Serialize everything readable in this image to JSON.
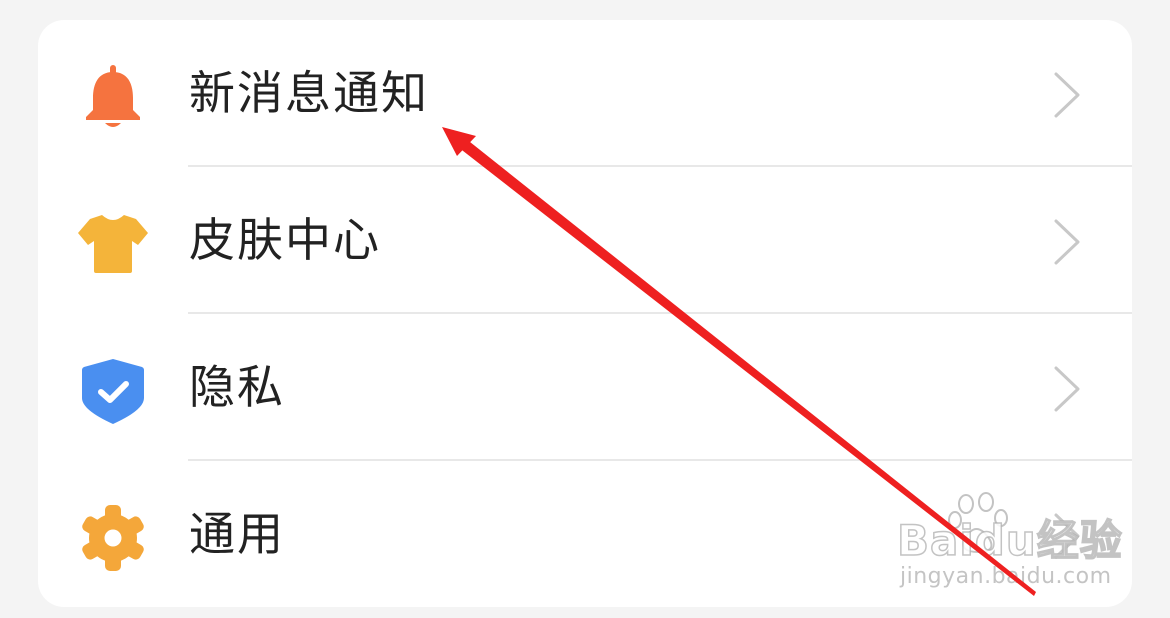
{
  "settings_list": {
    "items": [
      {
        "label": "新消息通知",
        "icon": "bell-icon",
        "icon_color": "#f5733f"
      },
      {
        "label": "皮肤中心",
        "icon": "tshirt-icon",
        "icon_color": "#f4b43a"
      },
      {
        "label": "隐私",
        "icon": "shield-check-icon",
        "icon_color": "#4a8ff0"
      },
      {
        "label": "通用",
        "icon": "gear-icon",
        "icon_color": "#f4a73a"
      }
    ]
  },
  "annotation": {
    "arrow_color": "#ee2020"
  },
  "watermark": {
    "brand": "Baidu经验",
    "url": "jingyan.baidu.com"
  }
}
